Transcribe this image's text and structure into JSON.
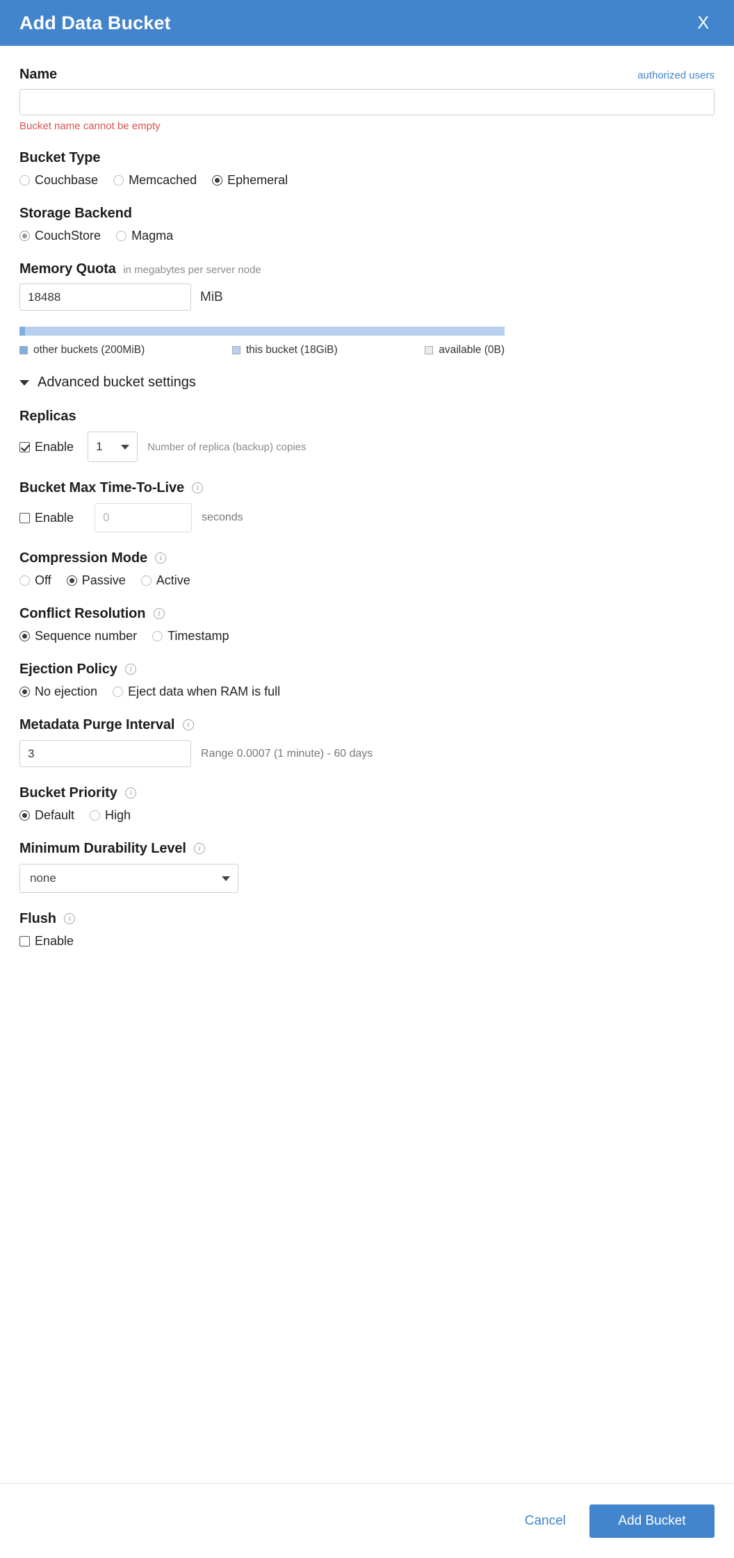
{
  "header": {
    "title": "Add Data Bucket",
    "close_label": "X",
    "bg_color": "#4285cc"
  },
  "name_field": {
    "label": "Name",
    "authorized_users_link": "authorized users",
    "value": "",
    "placeholder": "",
    "error": "Bucket name cannot be empty",
    "error_color": "#d9534f"
  },
  "bucket_type": {
    "label": "Bucket Type",
    "options": [
      {
        "label": "Couchbase",
        "selected": false
      },
      {
        "label": "Memcached",
        "selected": false
      },
      {
        "label": "Ephemeral",
        "selected": true
      }
    ]
  },
  "storage_backend": {
    "label": "Storage Backend",
    "options": [
      {
        "label": "CouchStore",
        "selected": true
      },
      {
        "label": "Magma",
        "selected": false
      }
    ]
  },
  "memory_quota": {
    "label": "Memory Quota",
    "sublabel": "in megabytes per server node",
    "value": "18488",
    "unit": "MiB"
  },
  "chart_data": {
    "type": "bar",
    "title": "Memory Quota allocation",
    "orientation": "horizontal-stacked",
    "categories": [
      "other buckets",
      "this bucket",
      "available"
    ],
    "values": [
      200,
      18432,
      0
    ],
    "value_unit": "MiB",
    "display_labels": [
      "other buckets (200MiB)",
      "this bucket (18GiB)",
      "available (0B)"
    ],
    "percentages": [
      1.1,
      98.9,
      0
    ],
    "colors": [
      "#80aee0",
      "#b8d0ee",
      "#eeece6"
    ],
    "legend": [
      "other buckets (200MiB)",
      "this bucket (18GiB)",
      "available (0B)"
    ],
    "legend_position": "bottom",
    "grid": false,
    "xlabel": "",
    "ylabel": ""
  },
  "advanced": {
    "label": "Advanced bucket settings",
    "expanded": true
  },
  "replicas": {
    "label": "Replicas",
    "enable_label": "Enable",
    "enabled": true,
    "count": "1",
    "hint": "Number of replica (backup) copies"
  },
  "max_ttl": {
    "label": "Bucket Max Time-To-Live",
    "enable_label": "Enable",
    "enabled": false,
    "value": "",
    "placeholder": "0",
    "unit": "seconds"
  },
  "compression_mode": {
    "label": "Compression Mode",
    "options": [
      {
        "label": "Off",
        "selected": false
      },
      {
        "label": "Passive",
        "selected": true
      },
      {
        "label": "Active",
        "selected": false
      }
    ]
  },
  "conflict_resolution": {
    "label": "Conflict Resolution",
    "options": [
      {
        "label": "Sequence number",
        "selected": true
      },
      {
        "label": "Timestamp",
        "selected": false
      }
    ]
  },
  "ejection_policy": {
    "label": "Ejection Policy",
    "options": [
      {
        "label": "No ejection",
        "selected": true
      },
      {
        "label": "Eject data when RAM is full",
        "selected": false
      }
    ]
  },
  "metadata_purge_interval": {
    "label": "Metadata Purge Interval",
    "value": "3",
    "hint": "Range 0.0007 (1 minute) - 60 days"
  },
  "bucket_priority": {
    "label": "Bucket Priority",
    "options": [
      {
        "label": "Default",
        "selected": true
      },
      {
        "label": "High",
        "selected": false
      }
    ]
  },
  "durability": {
    "label": "Minimum Durability Level",
    "value": "none"
  },
  "flush": {
    "label": "Flush",
    "enable_label": "Enable",
    "enabled": false
  },
  "footer": {
    "cancel_label": "Cancel",
    "submit_label": "Add Bucket"
  },
  "icons": {
    "info": "i"
  }
}
